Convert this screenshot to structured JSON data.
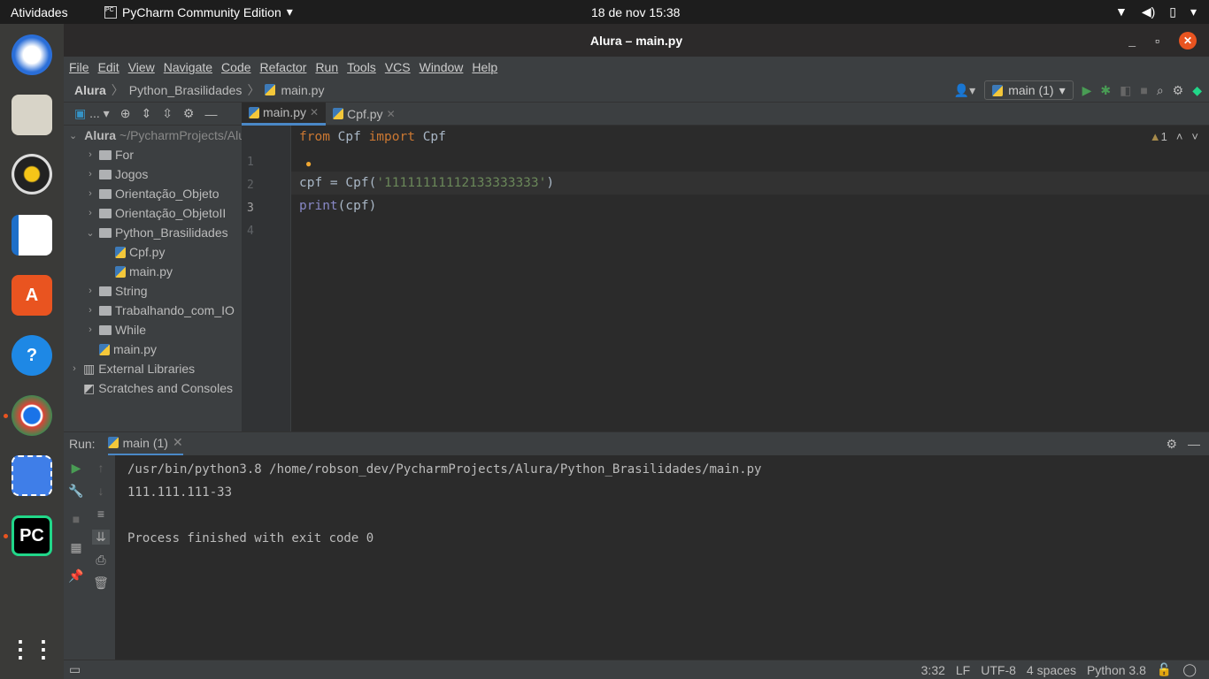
{
  "topbar": {
    "activities": "Atividades",
    "app": "PyCharm Community Edition",
    "clock": "18 de nov  15:38",
    "tray_icons": [
      "wifi-icon",
      "volume-icon",
      "battery-icon",
      "menu-down-icon"
    ]
  },
  "dock": [
    "thunderbird",
    "files",
    "rhythmbox",
    "libreoffice-writer",
    "software-center",
    "help",
    "chrome",
    "screenshot",
    "pycharm",
    "show-apps"
  ],
  "window": {
    "title": "Alura – main.py"
  },
  "menu": [
    "File",
    "Edit",
    "View",
    "Navigate",
    "Code",
    "Refactor",
    "Run",
    "Tools",
    "VCS",
    "Window",
    "Help"
  ],
  "breadcrumb": [
    "Alura",
    "Python_Brasilidades",
    "main.py"
  ],
  "run_config": "main (1)",
  "tabs": [
    {
      "label": "main.py"
    },
    {
      "label": "Cpf.py"
    }
  ],
  "project_toolbar": "...",
  "project_tree": [
    {
      "label": "Alura",
      "extra": "~/PycharmProjects/Alura",
      "level": 0,
      "type": "folder",
      "open": true
    },
    {
      "label": "For",
      "level": 1,
      "type": "folder"
    },
    {
      "label": "Jogos",
      "level": 1,
      "type": "folder"
    },
    {
      "label": "Orientação_Objeto",
      "level": 1,
      "type": "folder"
    },
    {
      "label": "Orientação_ObjetoII",
      "level": 1,
      "type": "folder"
    },
    {
      "label": "Python_Brasilidades",
      "level": 1,
      "type": "folder",
      "open": true
    },
    {
      "label": "Cpf.py",
      "level": 2,
      "type": "py"
    },
    {
      "label": "main.py",
      "level": 2,
      "type": "py"
    },
    {
      "label": "String",
      "level": 1,
      "type": "folder"
    },
    {
      "label": "Trabalhando_com_IO",
      "level": 1,
      "type": "folder"
    },
    {
      "label": "While",
      "level": 1,
      "type": "folder"
    },
    {
      "label": "main.py",
      "level": 1,
      "type": "py"
    },
    {
      "label": "External Libraries",
      "level": 0,
      "type": "lib"
    },
    {
      "label": "Scratches and Consoles",
      "level": 0,
      "type": "scratch"
    }
  ],
  "editor": {
    "line_numbers": [
      "1",
      "2",
      "3",
      "4"
    ],
    "line1": {
      "kw1": "from",
      "a": " Cpf ",
      "kw2": "import",
      "b": " Cpf"
    },
    "line3": {
      "a": "cpf = Cpf(",
      "s": "'11111111112133333333'",
      "b": ")"
    },
    "line4": {
      "fn": "print",
      "a": "(cpf)"
    },
    "warnings": "1"
  },
  "run": {
    "label": "Run:",
    "tab": "main (1)",
    "console": [
      "/usr/bin/python3.8 /home/robson_dev/PycharmProjects/Alura/Python_Brasilidades/main.py",
      "111.111.111-33",
      "",
      "Process finished with exit code 0"
    ]
  },
  "status": {
    "position": "3:32",
    "line_sep": "LF",
    "encoding": "UTF-8",
    "indent": "4 spaces",
    "interpreter": "Python 3.8"
  },
  "colors": {
    "accent": "#4a88c7",
    "keyword": "#cc7832",
    "string": "#6a8759",
    "builtin": "#8888c6",
    "close": "#e95420"
  }
}
